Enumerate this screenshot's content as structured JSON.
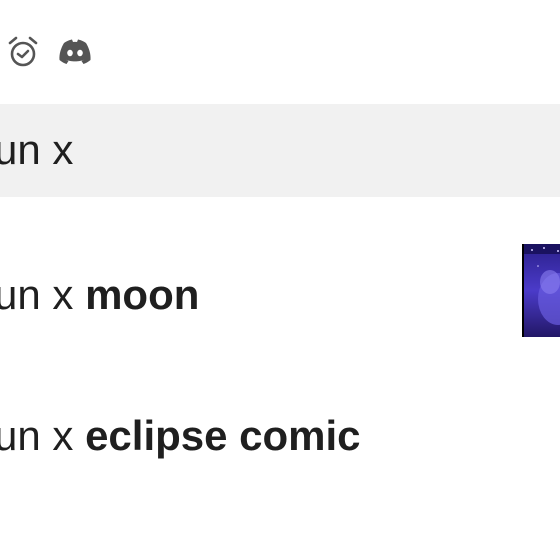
{
  "status_bar": {
    "icons": [
      "alarm-clock-icon",
      "discord-icon"
    ]
  },
  "search": {
    "query": "un x"
  },
  "suggestions": [
    {
      "query_part": "un x ",
      "completion": "moon",
      "thumbnail": "moon-artwork-thumbnail"
    },
    {
      "query_part": "un x ",
      "completion": "eclipse comic"
    }
  ],
  "colors": {
    "search_bar_bg": "#f1f1f1",
    "text": "#1f1f1f",
    "icon": "#555555",
    "thumbnail_accent": "#3b2aa8"
  }
}
